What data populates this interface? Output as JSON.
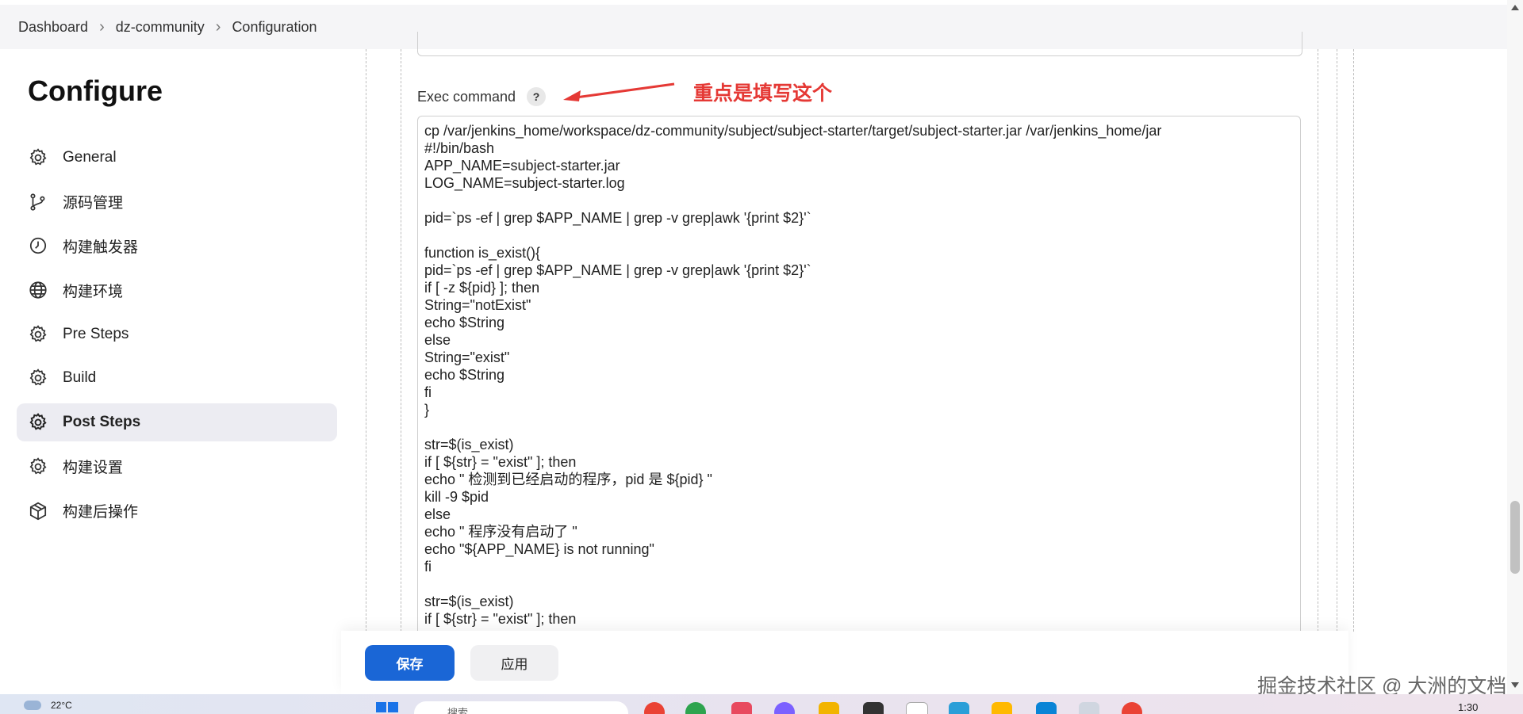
{
  "breadcrumb": [
    "Dashboard",
    "dz-community",
    "Configuration"
  ],
  "page": {
    "title": "Configure"
  },
  "sidebar": {
    "items": [
      {
        "label": "General",
        "icon": "gear-icon",
        "active": false
      },
      {
        "label": "源码管理",
        "icon": "branch-icon",
        "active": false
      },
      {
        "label": "构建触发器",
        "icon": "clock-icon",
        "active": false
      },
      {
        "label": "构建环境",
        "icon": "globe-icon",
        "active": false
      },
      {
        "label": "Pre Steps",
        "icon": "gear-icon",
        "active": false
      },
      {
        "label": "Build",
        "icon": "gear-icon",
        "active": false
      },
      {
        "label": "Post Steps",
        "icon": "gear-icon",
        "active": true
      },
      {
        "label": "构建设置",
        "icon": "gear-icon",
        "active": false
      },
      {
        "label": "构建后操作",
        "icon": "package-icon",
        "active": false
      }
    ]
  },
  "exec": {
    "label": "Exec command",
    "help": "?",
    "annotation": "重点是填写这个",
    "lines": [
      "cp /var/jenkins_home/workspace/dz-community/subject/subject-starter/target/subject-starter.jar /var/jenkins_home/jar",
      "#!/bin/bash",
      "APP_NAME=subject-starter.jar",
      "LOG_NAME=subject-starter.log",
      "",
      "pid=`ps -ef | grep $APP_NAME | grep -v grep|awk '{print $2}'`",
      "",
      "function is_exist(){",
      "pid=`ps -ef | grep $APP_NAME | grep -v grep|awk '{print $2}'`",
      "if [ -z ${pid} ]; then",
      "String=\"notExist\"",
      "echo $String",
      "else",
      "String=\"exist\"",
      "echo $String",
      "fi",
      "}",
      "",
      "str=$(is_exist)",
      "if [ ${str} = \"exist\" ]; then",
      "echo \" 检测到已经启动的程序，pid 是 ${pid} \"",
      "kill -9 $pid",
      "else",
      "echo \" 程序没有启动了 \"",
      "echo \"${APP_NAME} is not running\"",
      "fi",
      "",
      "str=$(is_exist)",
      "if [ ${str} = \"exist\" ]; then"
    ]
  },
  "actions": {
    "save_label": "保存",
    "apply_label": "应用"
  },
  "watermark": "掘金技术社区 @ 大洲的文档",
  "taskbar": {
    "weather": "22°C",
    "search_placeholder": "搜索",
    "time": "1:30"
  }
}
